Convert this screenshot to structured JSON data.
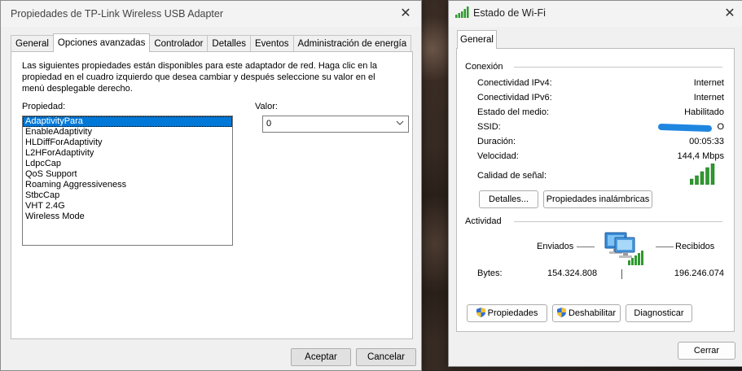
{
  "adapter_dialog": {
    "title": "Propiedades de TP-Link Wireless USB Adapter",
    "tabs": [
      {
        "label": "General"
      },
      {
        "label": "Opciones avanzadas"
      },
      {
        "label": "Controlador"
      },
      {
        "label": "Detalles"
      },
      {
        "label": "Eventos"
      },
      {
        "label": "Administración de energía"
      }
    ],
    "active_tab": "Opciones avanzadas",
    "description": "Las siguientes propiedades están disponibles para este adaptador de red. Haga clic en la propiedad en el cuadro izquierdo que desea cambiar y después seleccione su valor en el menú desplegable derecho.",
    "property_label": "Propiedad:",
    "value_label": "Valor:",
    "properties": [
      "AdaptivityPara",
      "EnableAdaptivity",
      "HLDiffForAdaptivity",
      "L2HForAdaptivity",
      "LdpcCap",
      "QoS Support",
      "Roaming Aggressiveness",
      "StbcCap",
      "VHT 2.4G",
      "Wireless Mode"
    ],
    "selected_property": "AdaptivityPara",
    "value": "0",
    "accept_label": "Aceptar",
    "cancel_label": "Cancelar"
  },
  "wifi_dialog": {
    "title": "Estado de Wi-Fi",
    "tab": "General",
    "connection": {
      "group_title": "Conexión",
      "ipv4_label": "Conectividad IPv4:",
      "ipv4_value": "Internet",
      "ipv6_label": "Conectividad IPv6:",
      "ipv6_value": "Internet",
      "media_label": "Estado del medio:",
      "media_value": "Habilitado",
      "ssid_label": "SSID:",
      "ssid_value": "O",
      "duration_label": "Duración:",
      "duration_value": "00:05:33",
      "speed_label": "Velocidad:",
      "speed_value": "144,4 Mbps",
      "signal_label": "Calidad de señal:",
      "signal_bars": 5,
      "details_button": "Detalles...",
      "wireless_props_button": "Propiedades inalámbricas"
    },
    "activity": {
      "group_title": "Actividad",
      "sent_label": "Enviados",
      "received_label": "Recibidos",
      "bytes_label": "Bytes:",
      "bytes_sent": "154.324.808",
      "bytes_received": "196.246.074"
    },
    "properties_button": "Propiedades",
    "disable_button": "Deshabilitar",
    "diagnose_button": "Diagnosticar",
    "close_button": "Cerrar"
  },
  "colors": {
    "selection": "#0078d7",
    "signal_green": "#2e9a2e",
    "redaction": "#1f86e0"
  }
}
